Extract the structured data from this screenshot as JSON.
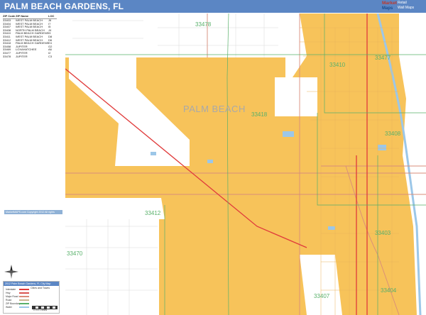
{
  "header": {
    "title": "PALM BEACH GARDENS, FL",
    "brand_line1": "Market",
    "brand_line2": "Maps",
    "brand_tag1": "Retail",
    "brand_tag2": "Wall Maps"
  },
  "zip_index": {
    "headers": [
      "ZIP Code",
      "ZIP Name",
      "LOC"
    ],
    "rows": [
      [
        "33403",
        "WEST PALM BEACH",
        "J6"
      ],
      [
        "33404",
        "WEST PALM BEACH",
        "I7"
      ],
      [
        "33407",
        "WEST PALM BEACH",
        "I5"
      ],
      [
        "33408",
        "NORTH PALM BEACH",
        "J4"
      ],
      [
        "33410",
        "PALM BEACH GARDENS",
        "I3"
      ],
      [
        "33411",
        "WEST PALM BEACH",
        "D8"
      ],
      [
        "33412",
        "WEST PALM BEACH",
        "D6"
      ],
      [
        "33418",
        "PALM BEACH GARDENS",
        "E4"
      ],
      [
        "33458",
        "JUPITER",
        "G2"
      ],
      [
        "33469",
        "LOXAHATCHEE",
        "A6"
      ],
      [
        "33477",
        "JUPITER",
        "I2"
      ],
      [
        "33478",
        "JUPITER",
        "C3"
      ]
    ]
  },
  "map": {
    "place_label": "PALM BEACH",
    "zip_labels": [
      {
        "id": "zip-33478-north",
        "text": "33478"
      },
      {
        "id": "zip-33410",
        "text": "33410"
      },
      {
        "id": "zip-33418",
        "text": "33418"
      },
      {
        "id": "zip-33408",
        "text": "33408"
      },
      {
        "id": "zip-33412",
        "text": "33412"
      },
      {
        "id": "zip-33403",
        "text": "33403"
      },
      {
        "id": "zip-33470",
        "text": "33470"
      },
      {
        "id": "zip-33407",
        "text": "33407"
      },
      {
        "id": "zip-33404",
        "text": "33404"
      },
      {
        "id": "zip-33477",
        "text": "33477"
      }
    ],
    "colors": {
      "zone_fill": "#f7c35a",
      "zone_fill_alt": "#f5c261",
      "water": "#9cc7e8",
      "highway": "#e03b3b",
      "road_major": "#d98c7a",
      "road_minor": "#c9b48e",
      "zip_boundary": "#58b06a",
      "open_area": "#ffffff"
    }
  },
  "legend": {
    "header": "2012 Palm Beach Gardens, FL City Map",
    "subheader": "Cities and Towns",
    "items": [
      "Interstate",
      "Hwy",
      "Major Road",
      "Road",
      "ZIP Boundary",
      "Water"
    ],
    "scale_label": "0  0.5  1  Miles"
  },
  "copyright": "MarketMAPS.com  Copyright 2012  All rights reserved"
}
